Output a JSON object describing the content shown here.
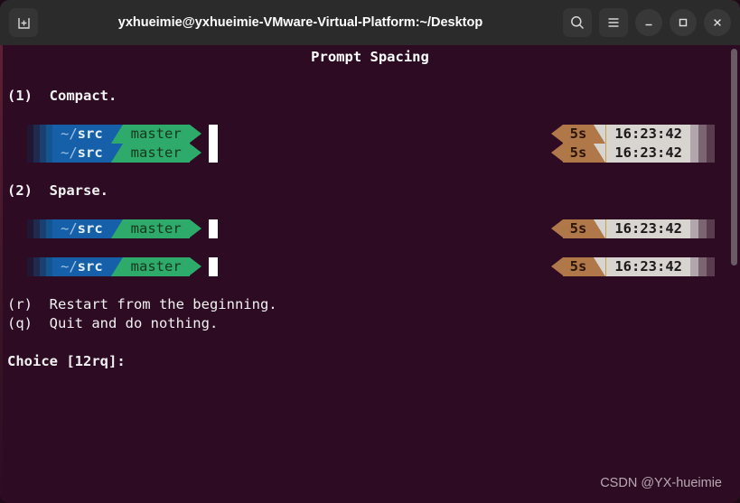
{
  "window": {
    "title": "yxhueimie@yxhueimie-VMware-Virtual-Platform:~/Desktop",
    "titlebar_bg": "#2b2b2b",
    "terminal_bg": "#2d0c23",
    "new_tab_icon": "new-tab-icon",
    "search_icon": "search-icon",
    "menu_icon": "hamburger-menu-icon",
    "minimize_icon": "minimize-icon",
    "maximize_icon": "maximize-icon",
    "close_icon": "close-icon"
  },
  "terminal": {
    "heading": "Prompt Spacing",
    "option_1": "(1)  Compact.",
    "option_2": "(2)  Sparse.",
    "option_r": "(r)  Restart from the beginning.",
    "option_q": "(q)  Quit and do nothing.",
    "choice_prompt": "Choice [12rq]:",
    "watermark": "CSDN @YX-hueimie"
  },
  "prompt_preview": {
    "dir_tilde": "~/",
    "dir_name": "src",
    "git_branch": "master",
    "duration": "5s",
    "time": "16:23:42",
    "colors": {
      "dir_bg": "#1560a8",
      "git_bg": "#2eaa6b",
      "duration_bg": "#b07848",
      "time_bg": "#d8d4d0",
      "cursor": "#ffffff"
    },
    "rows": [
      {
        "id": "compact-row-1"
      },
      {
        "id": "compact-row-2"
      },
      {
        "id": "sparse-row-1"
      },
      {
        "id": "sparse-row-2"
      }
    ]
  }
}
